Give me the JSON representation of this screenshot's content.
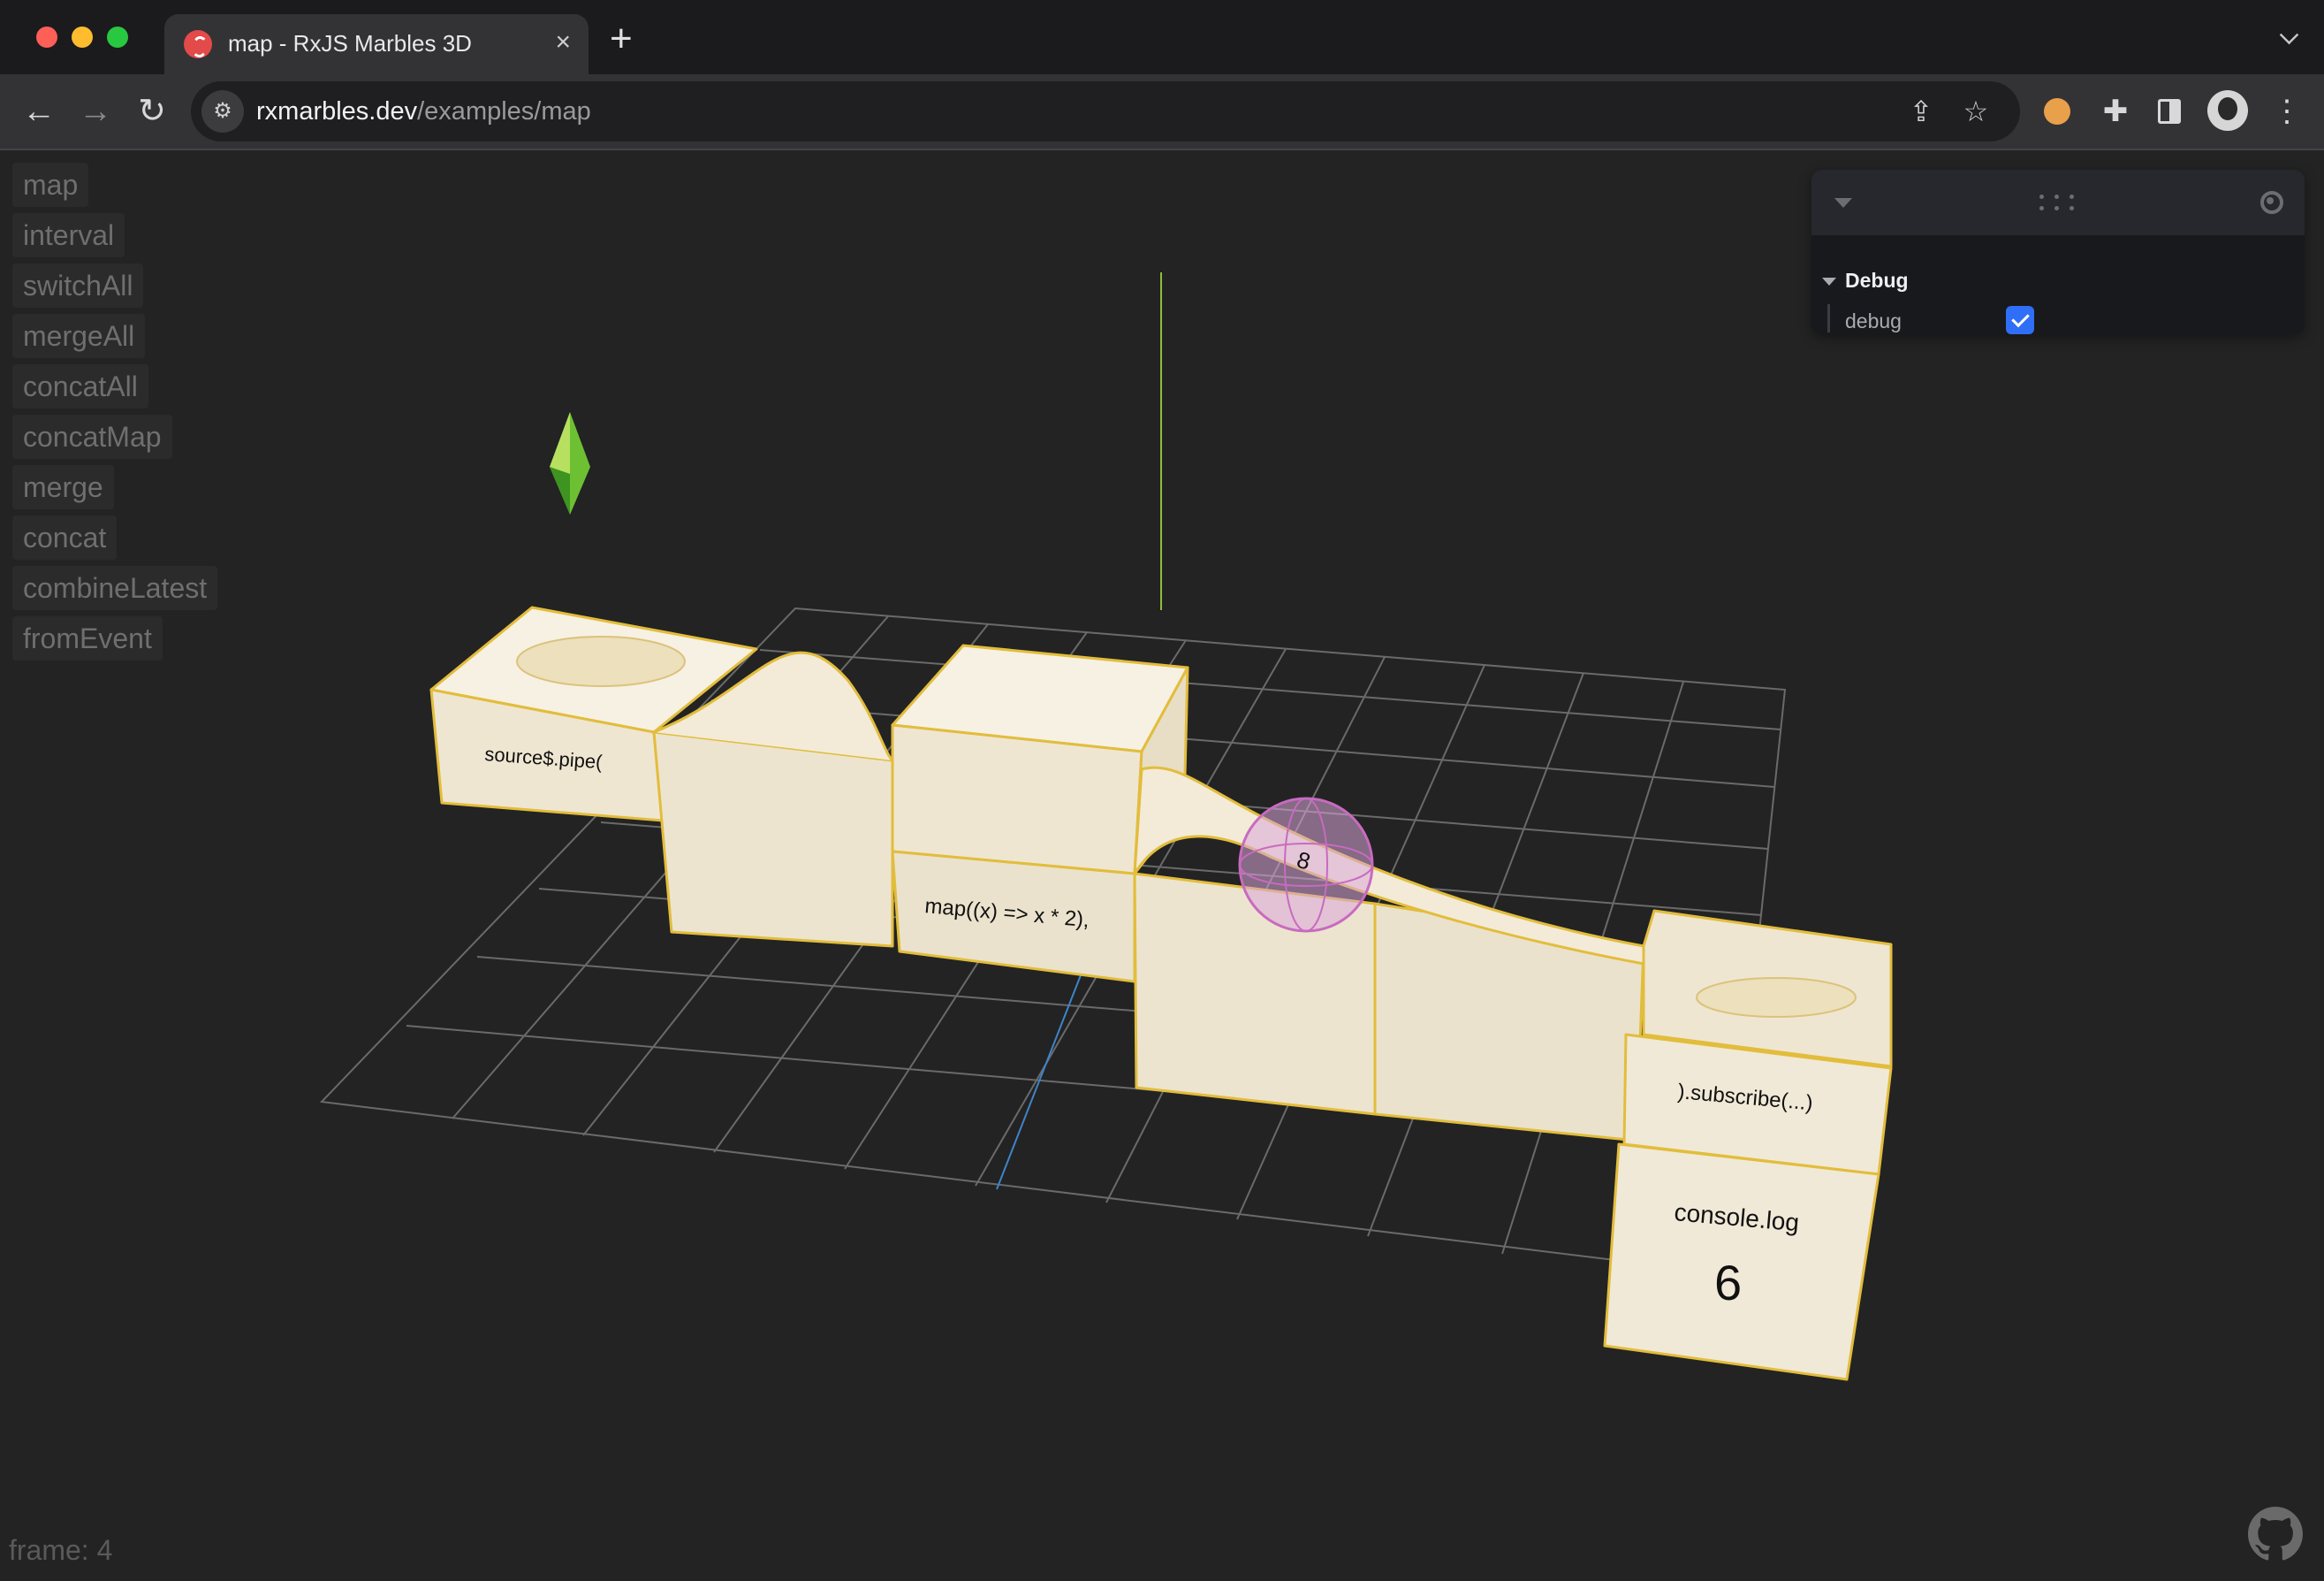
{
  "browser": {
    "tab_title": "map - RxJS Marbles 3D",
    "url_host": "rxmarbles.dev",
    "url_path": "/examples/map",
    "tab_close": "×",
    "new_tab": "+"
  },
  "examples": [
    "map",
    "interval",
    "switchAll",
    "mergeAll",
    "concatAll",
    "concatMap",
    "merge",
    "concat",
    "combineLatest",
    "fromEvent"
  ],
  "scene": {
    "labels": {
      "source": "source$.pipe(",
      "map": "map((x) => x * 2),",
      "subscribe": ").subscribe(...)",
      "console": "console.log",
      "output": "6",
      "marble": "8"
    },
    "colors": {
      "block": "#f1e9d7",
      "edge": "#e2bd3c",
      "grid": "#6a6a6a",
      "marble": "#c86bc0",
      "gem": "#7cc83a"
    }
  },
  "debug_panel": {
    "folder": "Debug",
    "label": "debug",
    "checked": true
  },
  "status": {
    "frame": "frame: 4"
  }
}
